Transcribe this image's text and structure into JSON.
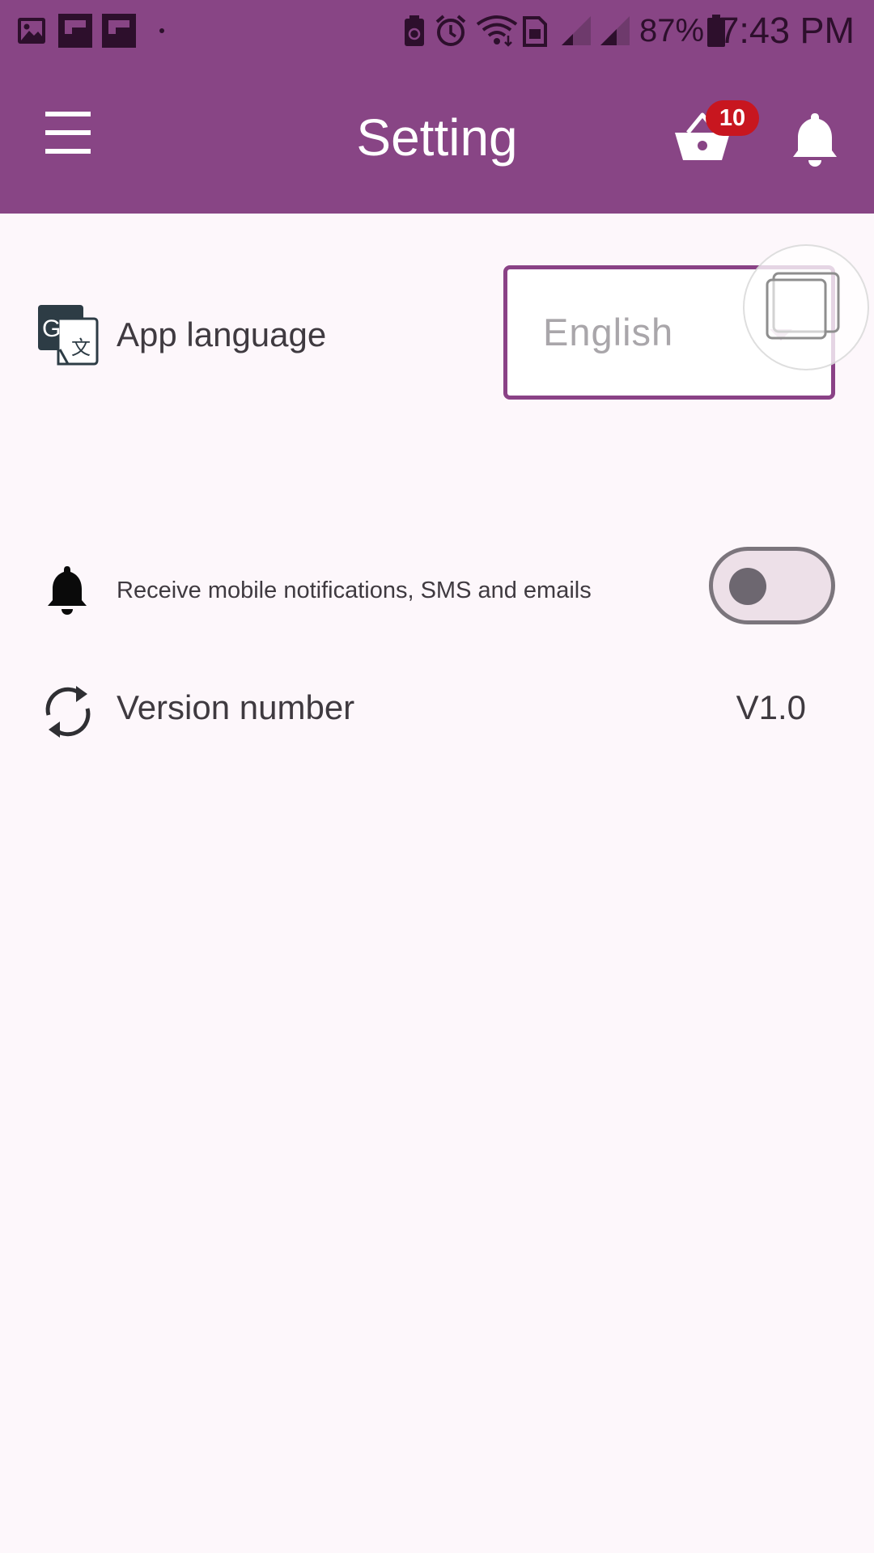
{
  "status_bar": {
    "battery_percent": "87%",
    "time": "7:43 PM"
  },
  "app_bar": {
    "title": "Setting",
    "cart_badge_count": "10",
    "colors": {
      "background": "#884585",
      "badge": "#c8161f"
    }
  },
  "settings": {
    "language": {
      "label": "App language",
      "selected_value": "English",
      "icon": "translate-icon"
    },
    "notifications": {
      "label": "Receive mobile notifications, SMS and emails",
      "enabled": false,
      "icon": "bell-icon"
    },
    "version": {
      "label": "Version number",
      "value": "V1.0",
      "icon": "refresh-icon"
    }
  }
}
